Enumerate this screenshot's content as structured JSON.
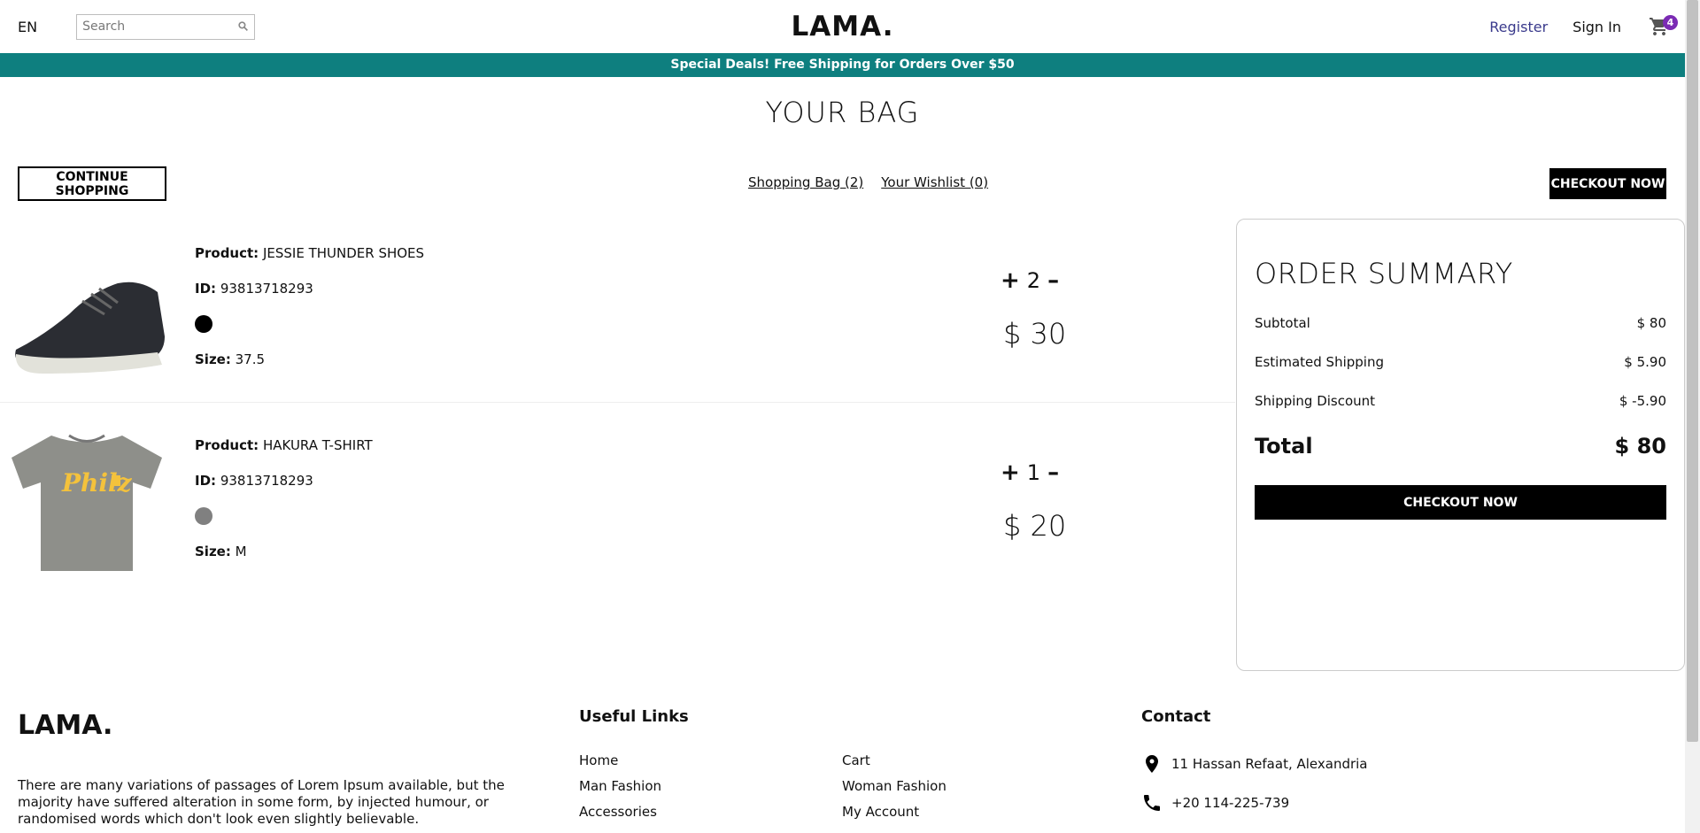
{
  "nav": {
    "lang": "EN",
    "search_placeholder": "Search",
    "logo": "LAMA.",
    "register": "Register",
    "signin": "Sign In",
    "cart_count": "4"
  },
  "announcement": "Special Deals! Free Shipping for Orders Over $50",
  "page_title": "YOUR BAG",
  "top": {
    "continue": "CONTINUE SHOPPING",
    "bag_link": "Shopping Bag (2)",
    "wishlist_link": "Your Wishlist (0)",
    "checkout": "CHECKOUT NOW"
  },
  "labels": {
    "product": "Product:",
    "id": "ID:",
    "size": "Size:"
  },
  "products": [
    {
      "name": "JESSIE THUNDER SHOES",
      "id": "93813718293",
      "color": "#000000",
      "size": "37.5",
      "qty": "2",
      "price": "$ 30"
    },
    {
      "name": "HAKURA T-SHIRT",
      "id": "93813718293",
      "color": "#808080",
      "size": "M",
      "qty": "1",
      "price": "$ 20"
    }
  ],
  "summary": {
    "title": "ORDER SUMMARY",
    "subtotal_label": "Subtotal",
    "subtotal": "$ 80",
    "shipping_label": "Estimated Shipping",
    "shipping": "$ 5.90",
    "discount_label": "Shipping Discount",
    "discount": "$ -5.90",
    "total_label": "Total",
    "total": "$ 80",
    "checkout": "CHECKOUT NOW"
  },
  "footer": {
    "logo": "LAMA.",
    "desc": "There are many variations of passages of Lorem Ipsum available, but the majority have suffered alteration in some form, by injected humour, or randomised words which don't look even slightly believable.",
    "links_title": "Useful Links",
    "links": [
      "Home",
      "Cart",
      "Man Fashion",
      "Woman Fashion",
      "Accessories",
      "My Account"
    ],
    "contact_title": "Contact",
    "address": "11 Hassan Refaat, Alexandria",
    "phone": "+20 114-225-739"
  }
}
